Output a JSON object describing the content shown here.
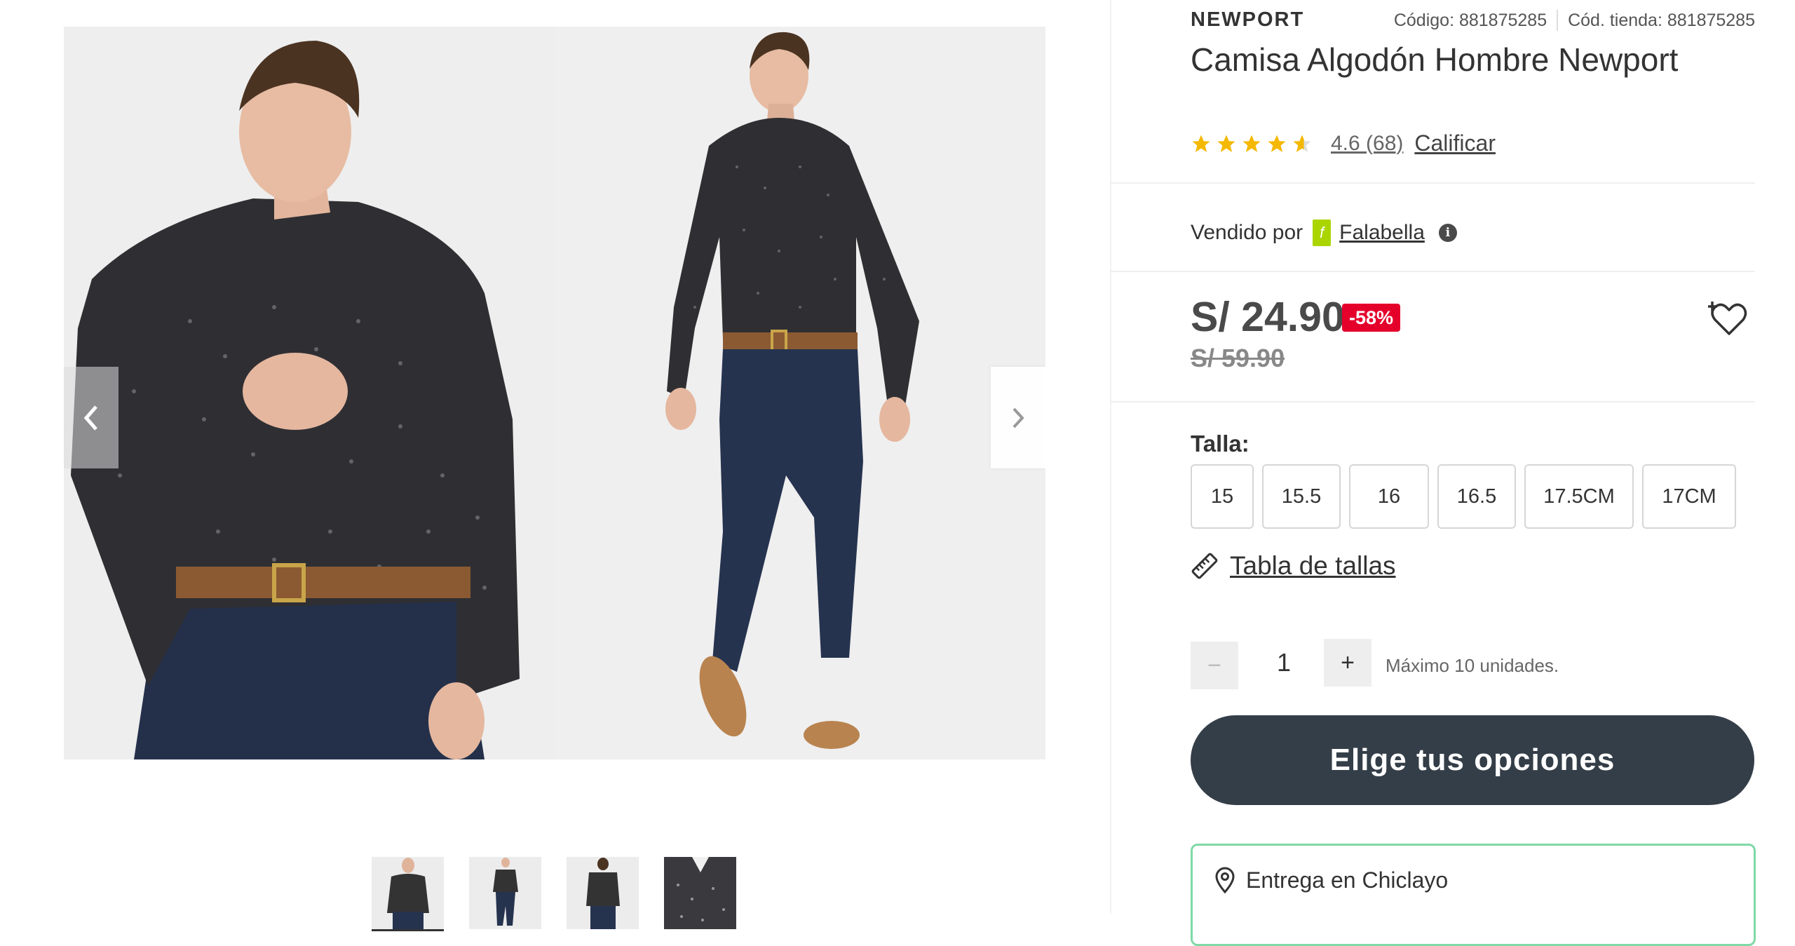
{
  "product": {
    "brand": "NEWPORT",
    "code": "Código: 881875285",
    "store_code": "Cód. tienda: 881875285",
    "title": "Camisa Algodón Hombre Newport",
    "rating": {
      "value": 4.6,
      "stars": 4.6,
      "text": "4.6 (68)",
      "rate_label": "Calificar"
    },
    "seller": {
      "label": "Vendido por",
      "badge": "f",
      "name": "Falabella"
    },
    "price": "S/ 24.90",
    "discount": "-58%",
    "old_price": "S/ 59.90",
    "size_label": "Talla:",
    "sizes": [
      "15",
      "15.5",
      "16",
      "16.5",
      "17.5CM",
      "17CM"
    ],
    "size_chart_label": "Tabla de tallas",
    "quantity": {
      "minus": "−",
      "value": "1",
      "plus": "+",
      "max_text": "Máximo 10 unidades."
    },
    "cta_label": "Elige tus opciones",
    "delivery_label": "Entrega en Chiclayo"
  },
  "colors": {
    "star": "#f5b800",
    "discount_bg": "#e4002b",
    "cta_bg": "#343e48",
    "seller_badge": "#aad500",
    "delivery_border": "#7fd9a6"
  },
  "icons": {
    "prev": "chevron-left-icon",
    "next": "chevron-right-icon",
    "wishlist": "heart-plus-icon",
    "ruler": "ruler-icon",
    "location": "location-pin-icon",
    "info": "info-icon"
  }
}
